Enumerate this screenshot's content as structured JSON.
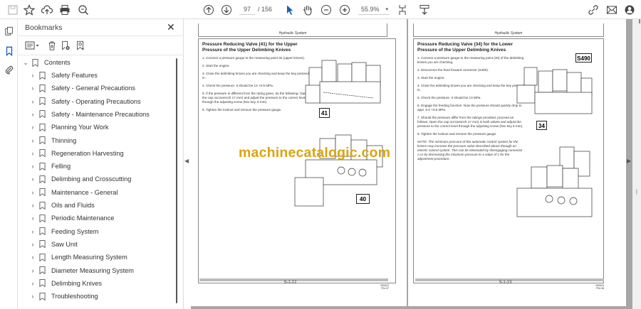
{
  "toolbar": {
    "icons": [
      "save-icon",
      "bookmark-star-icon",
      "cloud-upload-icon",
      "print-icon",
      "zoom-search-icon",
      "previous-page-icon",
      "next-page-icon",
      "select-cursor-icon",
      "hand-icon",
      "zoom-out-icon",
      "zoom-in-icon",
      "page-fit-icon",
      "scroll-mode-icon",
      "share-link-icon",
      "email-icon",
      "account-icon"
    ],
    "current_page": "97",
    "total_pages": "/ 156",
    "zoom_level": "55.9%",
    "zoom_dropdown": "▾"
  },
  "bookmarks": {
    "title": "Bookmarks",
    "close": "✕",
    "root": "Contents",
    "items": [
      "Safety Features",
      "Safety - General Precautions",
      "Safety - Operating Precautions",
      "Safety - Maintenance Precautions",
      "Planning Your Work",
      "Thinning",
      "Regeneration Harvesting",
      "Felling",
      "Delimbing and Crosscutting",
      "Maintenance - General",
      "Oils and Fluids",
      "Periodic Maintenance",
      "Feeding System",
      "Saw Unit",
      "Length Measuring System",
      "Diameter Measuring System",
      "Delimbing Knives",
      "Troubleshooting"
    ]
  },
  "pages": [
    {
      "header": "Hydraulic System",
      "title": "Pressure Reducing Valve (41) for the Upper Pressure of the Upper Delimbing Knives",
      "steps": [
        "1.  Connect a pressure gauge to the measuring point 40 (upper knives).",
        "2.  Start the engine.",
        "3.  Close the delimbing knives you are checking and keep the key pressed in.",
        "4.  Check the pressure. It should be 13 +0.5 MPa.",
        "5.  If the pressure is different from the rating given, do the following: Open the cap nut (wrench 17 mm) and adjust the pressure to the correct level through the adjusting screw (hex key, 6 mm).",
        "6.  Tighten the locknut and remove the pressure gauge."
      ],
      "callouts": [
        "41",
        "40"
      ],
      "page_number": "5-1-12",
      "page_code": "050623\nPN=37"
    },
    {
      "header": "Hydraulic System",
      "title": "Pressure Reducing Valve (34) for the Lower Pressure of the Upper Delimbing Knives",
      "steps": [
        "1.  Connect a pressure gauge to the measuring point (40) of the delimbing knives you are checking.",
        "2.  Disconnect the feed forward connector (S490).",
        "3.  Start the engine.",
        "4.  Close the delimbing knives you are checking and keep the key pressed in.",
        "5.  Check the pressure. It should be 13 MPa.",
        "6.  Engage the feeding function. Now the pressure should quickly drop to appr. 6.0 +0.5 MPa.",
        "7.  Should the pressure differ from the ratings provided, proceed as follows: Open the cap nut (wrench 17 mm) in both valves and adjust the pressure to the correct level through the adjusting screw (hex key 6 mm).",
        "8.  Tighten the locknut and remove the pressure gauge."
      ],
      "note": "NOTE:  The minimum pressure of the automatic control system for the knives may increase the pressure value described above through an electric control system. This can be eliminated by disengaging connector A or by decreasing the minimum pressure to a value of 1 for the adjustment procedure.",
      "callouts": [
        "S490",
        "34"
      ],
      "page_number": "5-1-13",
      "page_code": "050623\nPN=38"
    }
  ],
  "watermark": "machinecatalogic.com",
  "colors": {
    "accent": "#1a5fb4",
    "watermark": "#d9a40f",
    "doc_bg": "#a6a6a6"
  }
}
